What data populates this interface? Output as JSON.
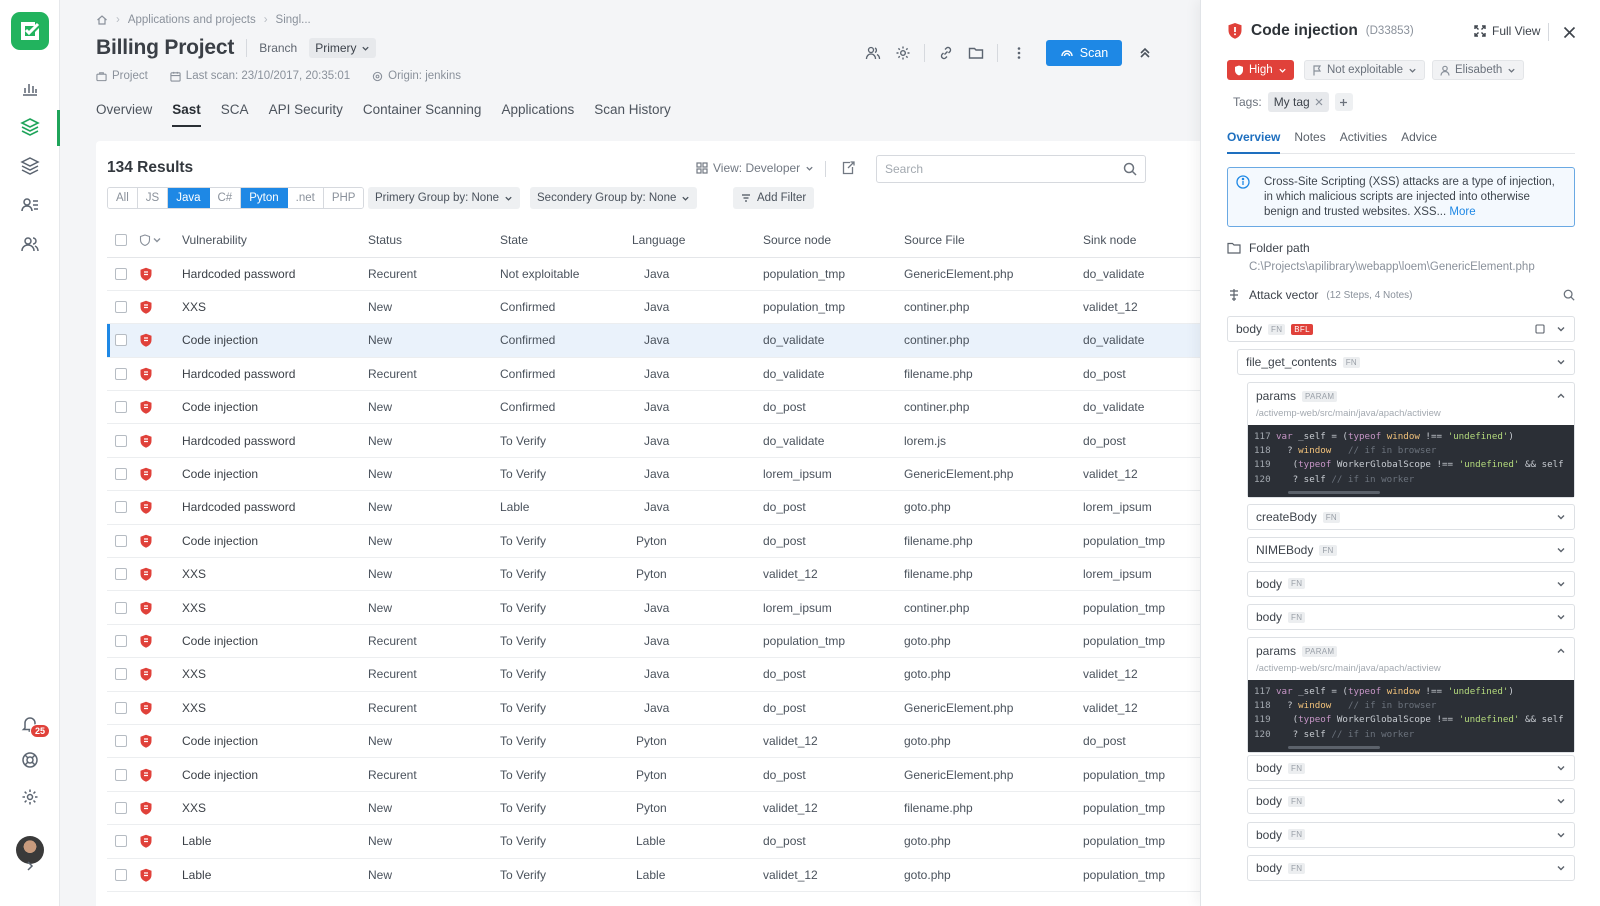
{
  "breadcrumb": [
    "Applications and projects",
    "Singl..."
  ],
  "project": {
    "title": "Billing Project",
    "branch_label": "Branch",
    "branch_value": "Primery",
    "type": "Project",
    "last_scan": "Last scan: 23/10/2017, 20:35:01",
    "origin": "Origin: jenkins"
  },
  "toolbar": {
    "scan_label": "Scan"
  },
  "tabs": [
    "Overview",
    "Sast",
    "SCA",
    "API Security",
    "Container Scanning",
    "Applications",
    "Scan History"
  ],
  "active_tab": "Sast",
  "notifications": {
    "count": "25"
  },
  "results": {
    "count_label": "134 Results",
    "view_label": "View: Developer",
    "search_placeholder": "Search",
    "languages": [
      "All",
      "JS",
      "Java",
      "C#",
      "Pyton",
      ".net",
      "PHP"
    ],
    "selected_languages": [
      "Java",
      "Pyton"
    ],
    "primary_group": "Primery Group by: None",
    "secondary_group": "Secondery Group by: None",
    "add_filter": "Add Filter",
    "columns": [
      "Vulnerability",
      "Status",
      "State",
      "Language",
      "Source node",
      "Source File",
      "Sink node"
    ],
    "rows": [
      [
        "Hardcoded password",
        "Recurent",
        "Not exploitable",
        "Java",
        "population_tmp",
        "GenericElement.php",
        "do_validate"
      ],
      [
        "XXS",
        "New",
        "Confirmed",
        "Java",
        "population_tmp",
        "continer.php",
        "validet_12"
      ],
      [
        "Code injection",
        "New",
        "Confirmed",
        "Java",
        "do_validate",
        "continer.php",
        "do_validate"
      ],
      [
        "Hardcoded password",
        "Recurent",
        "Confirmed",
        "Java",
        "do_validate",
        "filename.php",
        "do_post"
      ],
      [
        "Code injection",
        "New",
        "Confirmed",
        "Java",
        "do_post",
        "continer.php",
        "do_validate"
      ],
      [
        "Hardcoded password",
        "New",
        "To Verify",
        "Java",
        "do_validate",
        "lorem.js",
        "do_post"
      ],
      [
        "Code injection",
        "New",
        "To Verify",
        "Java",
        "lorem_ipsum",
        "GenericElement.php",
        "validet_12"
      ],
      [
        "Hardcoded password",
        "New",
        "Lable",
        "Java",
        "do_post",
        "goto.php",
        "lorem_ipsum"
      ],
      [
        "Code injection",
        "New",
        "To Verify",
        "Pyton",
        "do_post",
        "filename.php",
        "population_tmp"
      ],
      [
        "XXS",
        "New",
        "To Verify",
        "Pyton",
        "validet_12",
        "filename.php",
        "lorem_ipsum"
      ],
      [
        "XXS",
        "New",
        "To Verify",
        "Java",
        "lorem_ipsum",
        "continer.php",
        "population_tmp"
      ],
      [
        "Code injection",
        "Recurent",
        "To Verify",
        "Java",
        "population_tmp",
        "goto.php",
        "population_tmp"
      ],
      [
        "XXS",
        "Recurent",
        "To Verify",
        "Java",
        "do_post",
        "goto.php",
        "validet_12"
      ],
      [
        "XXS",
        "Recurent",
        "To Verify",
        "Java",
        "do_post",
        "GenericElement.php",
        "validet_12"
      ],
      [
        "Code injection",
        "New",
        "To Verify",
        "Pyton",
        "validet_12",
        "goto.php",
        "do_post"
      ],
      [
        "Code injection",
        "Recurent",
        "To Verify",
        "Pyton",
        "do_post",
        "GenericElement.php",
        "population_tmp"
      ],
      [
        "XXS",
        "New",
        "To Verify",
        "Pyton",
        "validet_12",
        "filename.php",
        "population_tmp"
      ],
      [
        "Lable",
        "New",
        "To Verify",
        "Lable",
        "do_post",
        "goto.php",
        "population_tmp"
      ],
      [
        "Lable",
        "New",
        "To Verify",
        "Lable",
        "validet_12",
        "goto.php",
        "population_tmp"
      ]
    ],
    "selected_row": 2
  },
  "panel": {
    "title": "Code injection",
    "id": "(D33853)",
    "full_view": "Full View",
    "severity": "High",
    "state": "Not exploitable",
    "assignee": "Elisabeth",
    "tags_label": "Tags:",
    "tags": [
      "My tag"
    ],
    "tabs": [
      "Overview",
      "Notes",
      "Activities",
      "Advice"
    ],
    "active_tab": "Overview",
    "description": "Cross-Site Scripting (XSS) attacks are a type of injection, in which malicious scripts are injected into otherwise benign and trusted websites. XSS...",
    "more_label": "More",
    "folder_label": "Folder path",
    "folder_path": "C:\\Projects\\apilibrary\\webapp\\loem\\GenericElement.php",
    "attack_label": "Attack vector",
    "attack_sub": "(12 Steps, 4 Notes)",
    "nodes": {
      "root": {
        "name": "body",
        "badges": [
          "FN",
          "BFL"
        ]
      },
      "file_get": {
        "name": "file_get_contents",
        "badge": "FN"
      },
      "params_name": "params",
      "params_badge": "PARAM",
      "params_path": "/activemp-web/src/main/java/apach/actiview",
      "list1": [
        {
          "name": "createBody",
          "badge": "FN"
        },
        {
          "name": "NIMEBody",
          "badge": "FN"
        },
        {
          "name": "body",
          "badge": "FN"
        },
        {
          "name": "body",
          "badge": "FN"
        }
      ],
      "list2": [
        {
          "name": "body",
          "badge": "FN"
        },
        {
          "name": "body",
          "badge": "FN"
        },
        {
          "name": "body",
          "badge": "FN"
        },
        {
          "name": "body",
          "badge": "FN"
        }
      ]
    },
    "code_lines": [
      "117",
      "118",
      "119",
      "120"
    ]
  },
  "colors": {
    "accent": "#1e88e5",
    "brand": "#22b35e",
    "danger": "#e0413a"
  }
}
